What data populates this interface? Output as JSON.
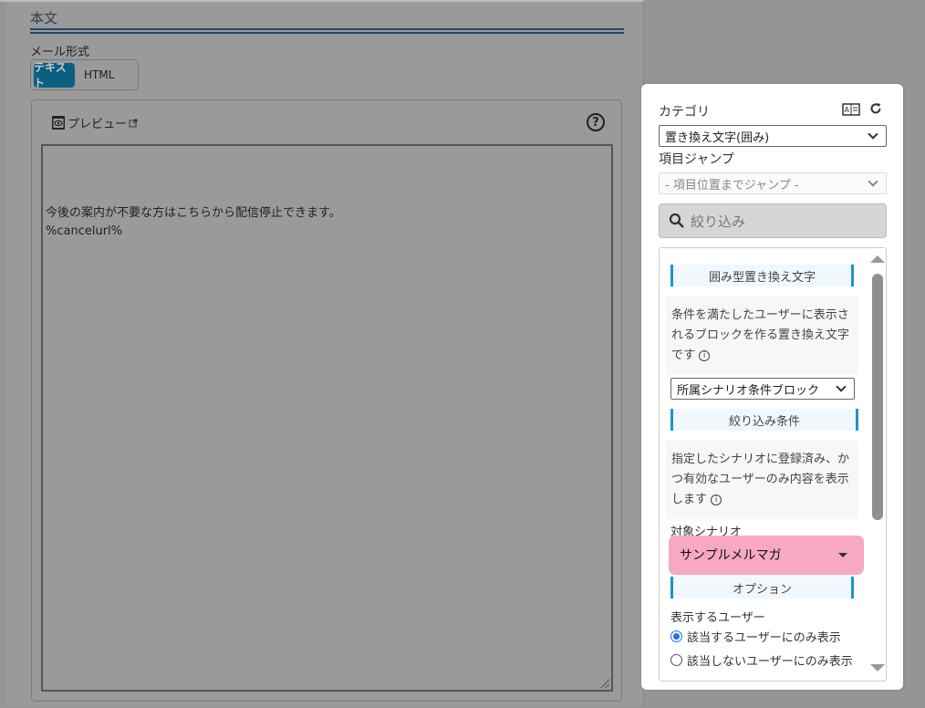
{
  "section_title": "本文",
  "mail_format": {
    "label": "メール形式",
    "options": [
      "テキスト",
      "HTML"
    ],
    "selected": "テキスト"
  },
  "preview": {
    "label": "プレビュー",
    "help": "?",
    "lines": [
      "今後の案内が不要な方はこちらから配信停止できます。",
      "%cancelurl%"
    ]
  },
  "panel": {
    "category_label": "カテゴリ",
    "category_value": "置き換え文字(囲み)",
    "jump_label": "項目ジャンプ",
    "jump_placeholder": "- 項目位置までジャンプ -",
    "search_placeholder": "絞り込み",
    "sec1": "囲み型置き換え文字",
    "desc1": "条件を満たしたユーザーに表示されるブロックを作る置き換え文字です",
    "block_select": "所属シナリオ条件ブロック",
    "sec2": "絞り込み条件",
    "desc2": "指定したシナリオに登録済み、かつ有効なユーザーのみ内容を表示します",
    "scenario_label": "対象シナリオ",
    "scenario_value": "サンプルメルマガ",
    "sec3": "オプション",
    "users_label": "表示するユーザー",
    "radio1": "該当するユーザーにのみ表示",
    "radio2": "該当しないユーザーにのみ表示",
    "info": "i"
  },
  "colors": {
    "accent": "#1a95c9",
    "highlight": "#f7a8c4",
    "toggle_on": "#0d5f80"
  }
}
